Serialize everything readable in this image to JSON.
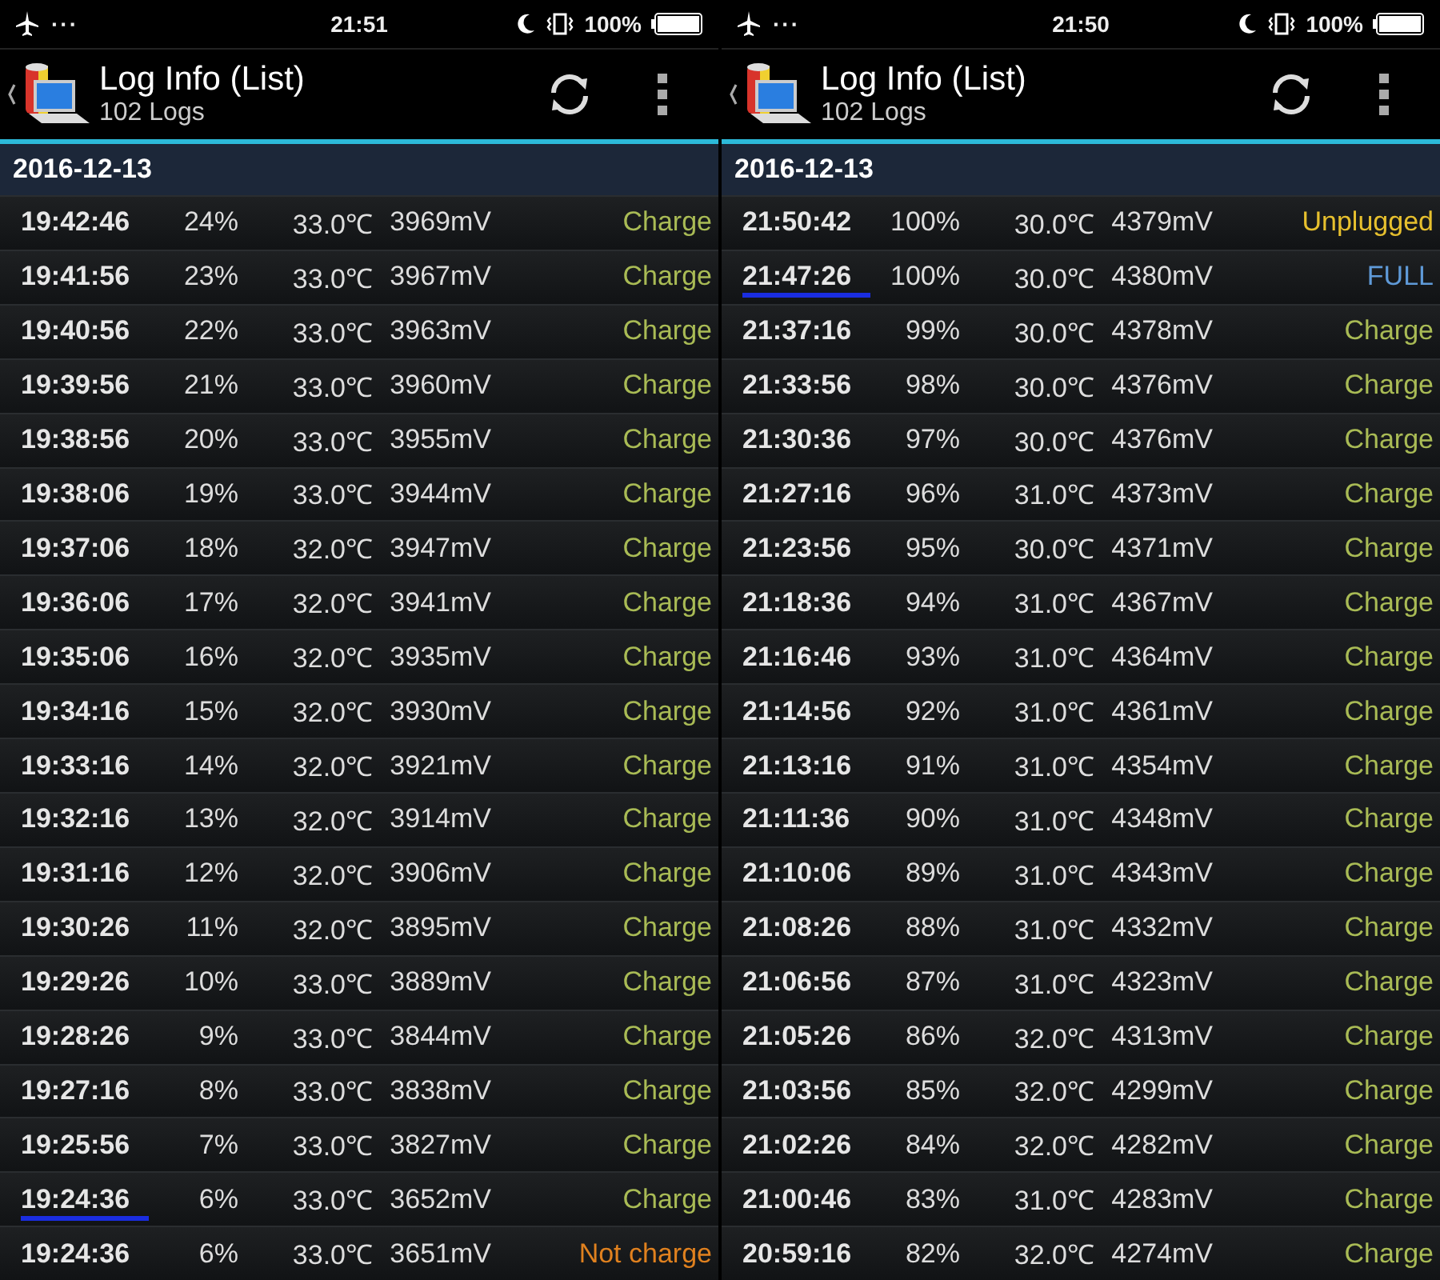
{
  "panels": [
    {
      "status_bar": {
        "dots": "···",
        "time": "21:51",
        "battery": "100%"
      },
      "title": "Log Info (List)",
      "subtitle": "102 Logs",
      "date": "2016-12-13",
      "rows": [
        {
          "time": "19:42:46",
          "percent": "24%",
          "temp": "33.0℃",
          "voltage": "3969mV",
          "status": "Charge",
          "kind": "charge",
          "underlined": false
        },
        {
          "time": "19:41:56",
          "percent": "23%",
          "temp": "33.0℃",
          "voltage": "3967mV",
          "status": "Charge",
          "kind": "charge",
          "underlined": false
        },
        {
          "time": "19:40:56",
          "percent": "22%",
          "temp": "33.0℃",
          "voltage": "3963mV",
          "status": "Charge",
          "kind": "charge",
          "underlined": false
        },
        {
          "time": "19:39:56",
          "percent": "21%",
          "temp": "33.0℃",
          "voltage": "3960mV",
          "status": "Charge",
          "kind": "charge",
          "underlined": false
        },
        {
          "time": "19:38:56",
          "percent": "20%",
          "temp": "33.0℃",
          "voltage": "3955mV",
          "status": "Charge",
          "kind": "charge",
          "underlined": false
        },
        {
          "time": "19:38:06",
          "percent": "19%",
          "temp": "33.0℃",
          "voltage": "3944mV",
          "status": "Charge",
          "kind": "charge",
          "underlined": false
        },
        {
          "time": "19:37:06",
          "percent": "18%",
          "temp": "32.0℃",
          "voltage": "3947mV",
          "status": "Charge",
          "kind": "charge",
          "underlined": false
        },
        {
          "time": "19:36:06",
          "percent": "17%",
          "temp": "32.0℃",
          "voltage": "3941mV",
          "status": "Charge",
          "kind": "charge",
          "underlined": false
        },
        {
          "time": "19:35:06",
          "percent": "16%",
          "temp": "32.0℃",
          "voltage": "3935mV",
          "status": "Charge",
          "kind": "charge",
          "underlined": false
        },
        {
          "time": "19:34:16",
          "percent": "15%",
          "temp": "32.0℃",
          "voltage": "3930mV",
          "status": "Charge",
          "kind": "charge",
          "underlined": false
        },
        {
          "time": "19:33:16",
          "percent": "14%",
          "temp": "32.0℃",
          "voltage": "3921mV",
          "status": "Charge",
          "kind": "charge",
          "underlined": false
        },
        {
          "time": "19:32:16",
          "percent": "13%",
          "temp": "32.0℃",
          "voltage": "3914mV",
          "status": "Charge",
          "kind": "charge",
          "underlined": false
        },
        {
          "time": "19:31:16",
          "percent": "12%",
          "temp": "32.0℃",
          "voltage": "3906mV",
          "status": "Charge",
          "kind": "charge",
          "underlined": false
        },
        {
          "time": "19:30:26",
          "percent": "11%",
          "temp": "32.0℃",
          "voltage": "3895mV",
          "status": "Charge",
          "kind": "charge",
          "underlined": false
        },
        {
          "time": "19:29:26",
          "percent": "10%",
          "temp": "33.0℃",
          "voltage": "3889mV",
          "status": "Charge",
          "kind": "charge",
          "underlined": false
        },
        {
          "time": "19:28:26",
          "percent": "9%",
          "temp": "33.0℃",
          "voltage": "3844mV",
          "status": "Charge",
          "kind": "charge",
          "underlined": false
        },
        {
          "time": "19:27:16",
          "percent": "8%",
          "temp": "33.0℃",
          "voltage": "3838mV",
          "status": "Charge",
          "kind": "charge",
          "underlined": false
        },
        {
          "time": "19:25:56",
          "percent": "7%",
          "temp": "33.0℃",
          "voltage": "3827mV",
          "status": "Charge",
          "kind": "charge",
          "underlined": false
        },
        {
          "time": "19:24:36",
          "percent": "6%",
          "temp": "33.0℃",
          "voltage": "3652mV",
          "status": "Charge",
          "kind": "charge",
          "underlined": true
        },
        {
          "time": "19:24:36",
          "percent": "6%",
          "temp": "33.0℃",
          "voltage": "3651mV",
          "status": "Not charge",
          "kind": "not_charge",
          "underlined": false
        }
      ]
    },
    {
      "status_bar": {
        "dots": "···",
        "time": "21:50",
        "battery": "100%"
      },
      "title": "Log Info (List)",
      "subtitle": "102 Logs",
      "date": "2016-12-13",
      "rows": [
        {
          "time": "21:50:42",
          "percent": "100%",
          "temp": "30.0℃",
          "voltage": "4379mV",
          "status": "Unplugged",
          "kind": "unplugged",
          "underlined": false
        },
        {
          "time": "21:47:26",
          "percent": "100%",
          "temp": "30.0℃",
          "voltage": "4380mV",
          "status": "FULL",
          "kind": "full",
          "underlined": true
        },
        {
          "time": "21:37:16",
          "percent": "99%",
          "temp": "30.0℃",
          "voltage": "4378mV",
          "status": "Charge",
          "kind": "charge",
          "underlined": false
        },
        {
          "time": "21:33:56",
          "percent": "98%",
          "temp": "30.0℃",
          "voltage": "4376mV",
          "status": "Charge",
          "kind": "charge",
          "underlined": false
        },
        {
          "time": "21:30:36",
          "percent": "97%",
          "temp": "30.0℃",
          "voltage": "4376mV",
          "status": "Charge",
          "kind": "charge",
          "underlined": false
        },
        {
          "time": "21:27:16",
          "percent": "96%",
          "temp": "31.0℃",
          "voltage": "4373mV",
          "status": "Charge",
          "kind": "charge",
          "underlined": false
        },
        {
          "time": "21:23:56",
          "percent": "95%",
          "temp": "30.0℃",
          "voltage": "4371mV",
          "status": "Charge",
          "kind": "charge",
          "underlined": false
        },
        {
          "time": "21:18:36",
          "percent": "94%",
          "temp": "31.0℃",
          "voltage": "4367mV",
          "status": "Charge",
          "kind": "charge",
          "underlined": false
        },
        {
          "time": "21:16:46",
          "percent": "93%",
          "temp": "31.0℃",
          "voltage": "4364mV",
          "status": "Charge",
          "kind": "charge",
          "underlined": false
        },
        {
          "time": "21:14:56",
          "percent": "92%",
          "temp": "31.0℃",
          "voltage": "4361mV",
          "status": "Charge",
          "kind": "charge",
          "underlined": false
        },
        {
          "time": "21:13:16",
          "percent": "91%",
          "temp": "31.0℃",
          "voltage": "4354mV",
          "status": "Charge",
          "kind": "charge",
          "underlined": false
        },
        {
          "time": "21:11:36",
          "percent": "90%",
          "temp": "31.0℃",
          "voltage": "4348mV",
          "status": "Charge",
          "kind": "charge",
          "underlined": false
        },
        {
          "time": "21:10:06",
          "percent": "89%",
          "temp": "31.0℃",
          "voltage": "4343mV",
          "status": "Charge",
          "kind": "charge",
          "underlined": false
        },
        {
          "time": "21:08:26",
          "percent": "88%",
          "temp": "31.0℃",
          "voltage": "4332mV",
          "status": "Charge",
          "kind": "charge",
          "underlined": false
        },
        {
          "time": "21:06:56",
          "percent": "87%",
          "temp": "31.0℃",
          "voltage": "4323mV",
          "status": "Charge",
          "kind": "charge",
          "underlined": false
        },
        {
          "time": "21:05:26",
          "percent": "86%",
          "temp": "32.0℃",
          "voltage": "4313mV",
          "status": "Charge",
          "kind": "charge",
          "underlined": false
        },
        {
          "time": "21:03:56",
          "percent": "85%",
          "temp": "32.0℃",
          "voltage": "4299mV",
          "status": "Charge",
          "kind": "charge",
          "underlined": false
        },
        {
          "time": "21:02:26",
          "percent": "84%",
          "temp": "32.0℃",
          "voltage": "4282mV",
          "status": "Charge",
          "kind": "charge",
          "underlined": false
        },
        {
          "time": "21:00:46",
          "percent": "83%",
          "temp": "31.0℃",
          "voltage": "4283mV",
          "status": "Charge",
          "kind": "charge",
          "underlined": false
        },
        {
          "time": "20:59:16",
          "percent": "82%",
          "temp": "32.0℃",
          "voltage": "4274mV",
          "status": "Charge",
          "kind": "charge",
          "underlined": false
        }
      ]
    }
  ]
}
